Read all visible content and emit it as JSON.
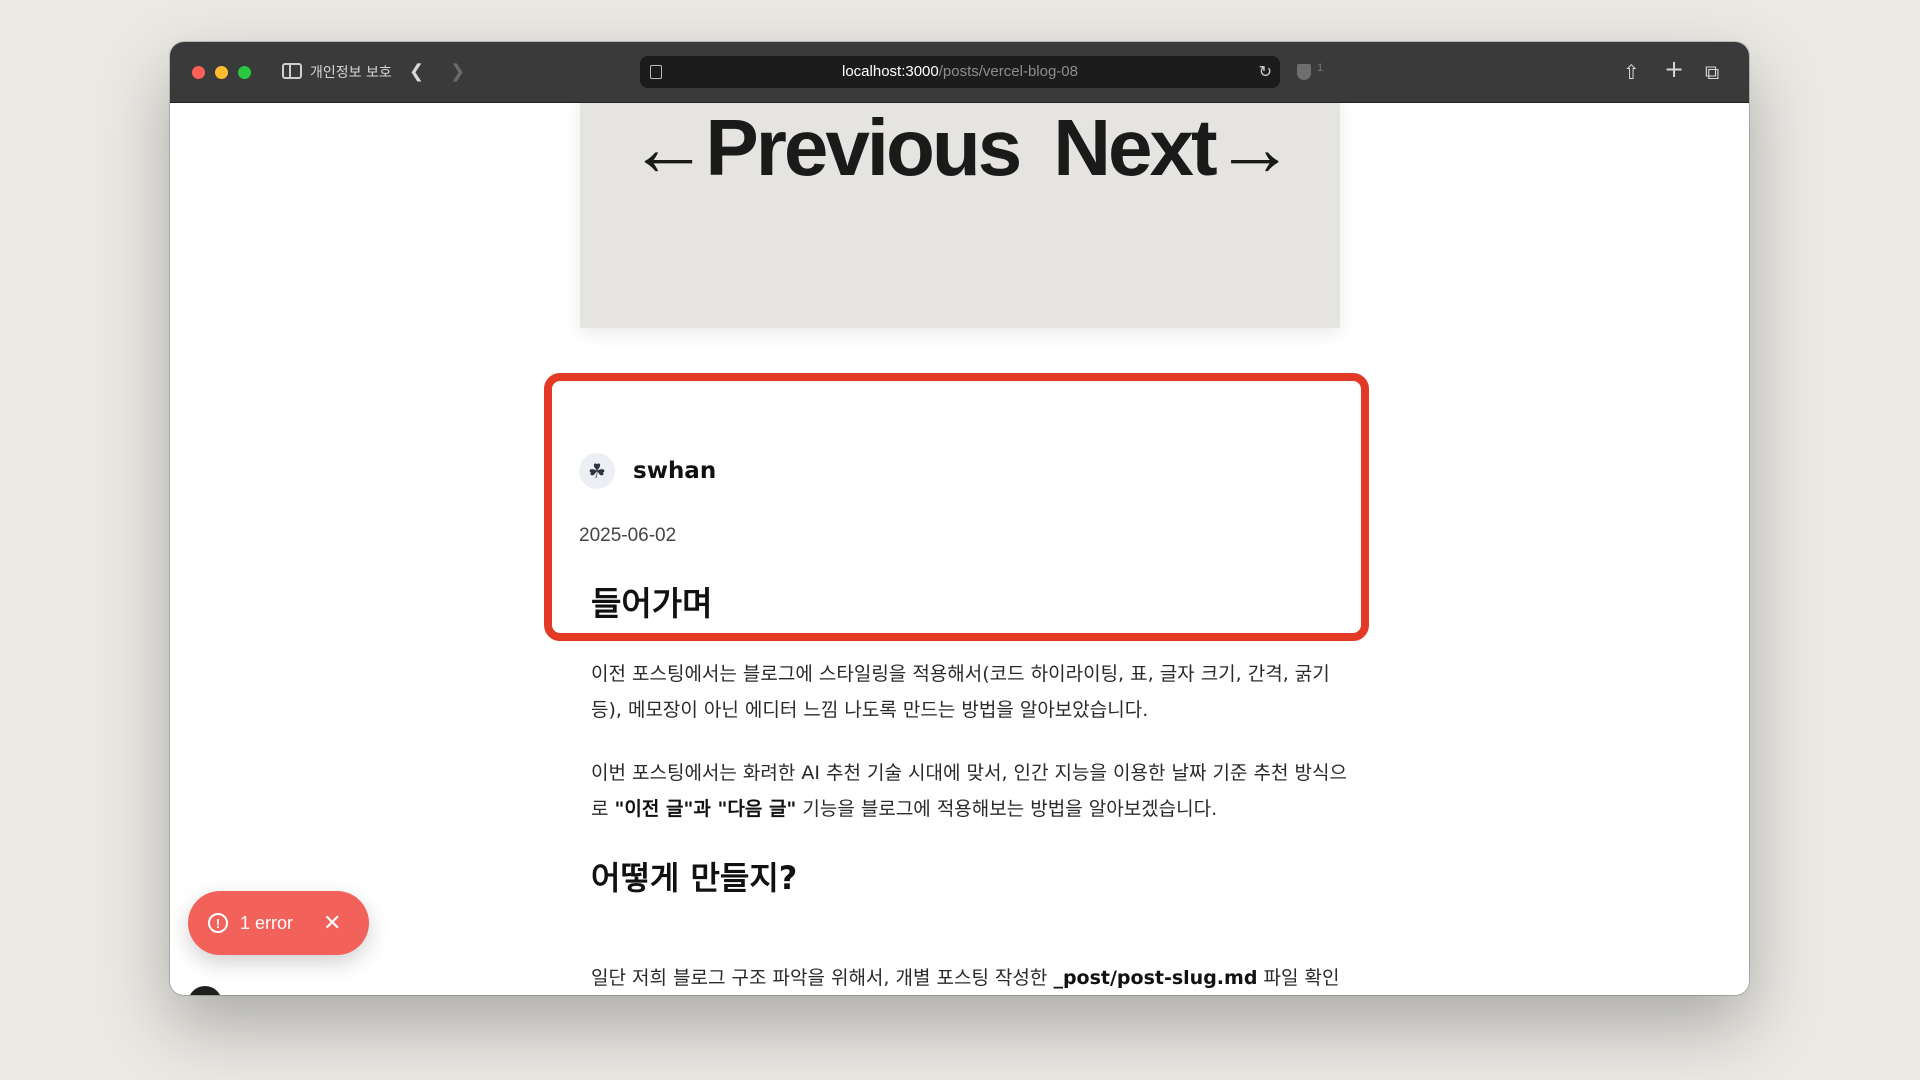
{
  "browser": {
    "private_label": "개인정보 보호",
    "url_host": "localhost:3000",
    "url_path": "/posts/vercel-blog-08",
    "tracker_count": "1"
  },
  "cover": {
    "prev_text": "←Previous",
    "next_text": "Next→"
  },
  "post": {
    "author": "swhan",
    "date": "2025-06-02",
    "title": "들어가며",
    "paragraph1": "이전 포스팅에서는 블로그에 스타일링을 적용해서(코드 하이라이팅, 표, 글자 크기, 간격, 굵기 등), 메모장이 아닌 에디터 느낌 나도록 만드는 방법을 알아보았습니다.",
    "paragraph2_before": "이번 포스팅에서는 화려한 AI 추천 기술 시대에 맞서, 인간 지능을 이용한 날짜 기준 추천 방식으로 ",
    "paragraph2_bold": "\"이전 글\"과 \"다음 글\"",
    "paragraph2_after": " 기능을 블로그에 적용해보는 방법을 알아보겠습니다.",
    "heading2": "어떻게 만들지?",
    "paragraph3_before": "일단 저희 블로그 구조 파악을 위해서, 개별 포스팅 작성한 ",
    "paragraph3_bold": "_post/post-slug.md",
    "paragraph3_after": " 파일 확인해보면"
  },
  "devtools": {
    "error_label": "1 error"
  },
  "icons": {
    "sidebar": "sidebar-icon",
    "back": "chevron-left-icon",
    "forward": "chevron-right-icon",
    "share": "share-icon",
    "new_tab": "plus-icon",
    "tabs": "tabs-overview-icon",
    "reload": "reload-icon",
    "avatar": "swan-icon",
    "error": "alert-circle-icon",
    "close": "close-icon",
    "next_logo": "bolt-icon"
  },
  "colors": {
    "highlight": "#e23a25",
    "error_pill": "#f2615a",
    "cover_bg": "#e5e4e0"
  }
}
